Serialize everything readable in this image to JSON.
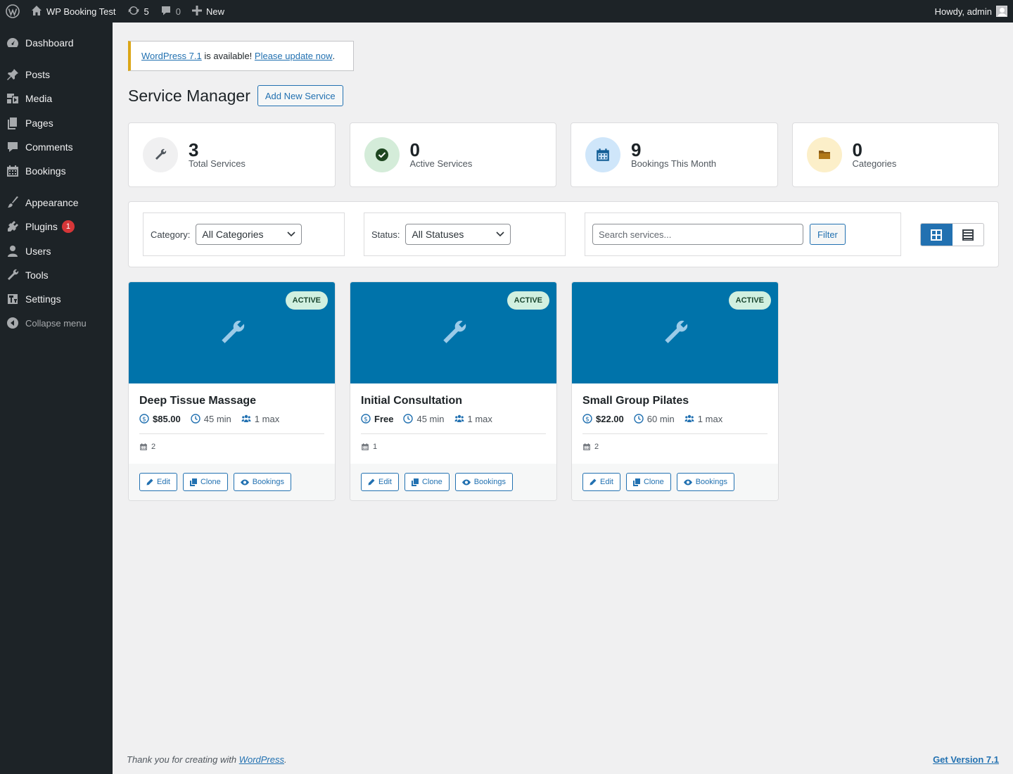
{
  "adminbar": {
    "site_name": "WP Booking Test",
    "updates_count": "5",
    "comments_count": "0",
    "new_label": "New",
    "howdy": "Howdy, admin"
  },
  "sidebar": {
    "items": [
      {
        "label": "Dashboard"
      },
      {
        "label": "Posts"
      },
      {
        "label": "Media"
      },
      {
        "label": "Pages"
      },
      {
        "label": "Comments"
      },
      {
        "label": "Bookings"
      },
      {
        "label": "Appearance"
      },
      {
        "label": "Plugins",
        "badge": "1"
      },
      {
        "label": "Users"
      },
      {
        "label": "Tools"
      },
      {
        "label": "Settings"
      },
      {
        "label": "Collapse menu"
      }
    ]
  },
  "notice": {
    "link_version": "WordPress 7.1",
    "middle": " is available! ",
    "link_update": "Please update now",
    "end": "."
  },
  "page": {
    "title": "Service Manager",
    "add_button": "Add New Service"
  },
  "stats": [
    {
      "value": "3",
      "label": "Total Services",
      "icon": "wrench-icon"
    },
    {
      "value": "0",
      "label": "Active Services",
      "icon": "check-circle-icon"
    },
    {
      "value": "9",
      "label": "Bookings This Month",
      "icon": "calendar-icon"
    },
    {
      "value": "0",
      "label": "Categories",
      "icon": "folder-icon"
    }
  ],
  "filters": {
    "category_label": "Category:",
    "category_value": "All Categories",
    "status_label": "Status:",
    "status_value": "All Statuses",
    "search_placeholder": "Search services...",
    "filter_button": "Filter"
  },
  "services": [
    {
      "status": "ACTIVE",
      "title": "Deep Tissue Massage",
      "price": "$85.00",
      "duration": "45 min",
      "capacity": "1 max",
      "bookings": "2"
    },
    {
      "status": "ACTIVE",
      "title": "Initial Consultation",
      "price": "Free",
      "duration": "45 min",
      "capacity": "1 max",
      "bookings": "1"
    },
    {
      "status": "ACTIVE",
      "title": "Small Group Pilates",
      "price": "$22.00",
      "duration": "60 min",
      "capacity": "1 max",
      "bookings": "2"
    }
  ],
  "card_actions": {
    "edit": "Edit",
    "clone": "Clone",
    "bookings": "Bookings"
  },
  "footer": {
    "thanks_prefix": "Thank you for creating with ",
    "thanks_link": "WordPress",
    "thanks_suffix": ".",
    "version_link": "Get Version 7.1"
  },
  "colors": {
    "admin_dark": "#1d2327",
    "primary_blue": "#2271b1",
    "hero_blue": "#0073aa",
    "active_pill": "#d1f0e0",
    "notice_yellow": "#dba617",
    "badge_red": "#d63638"
  }
}
